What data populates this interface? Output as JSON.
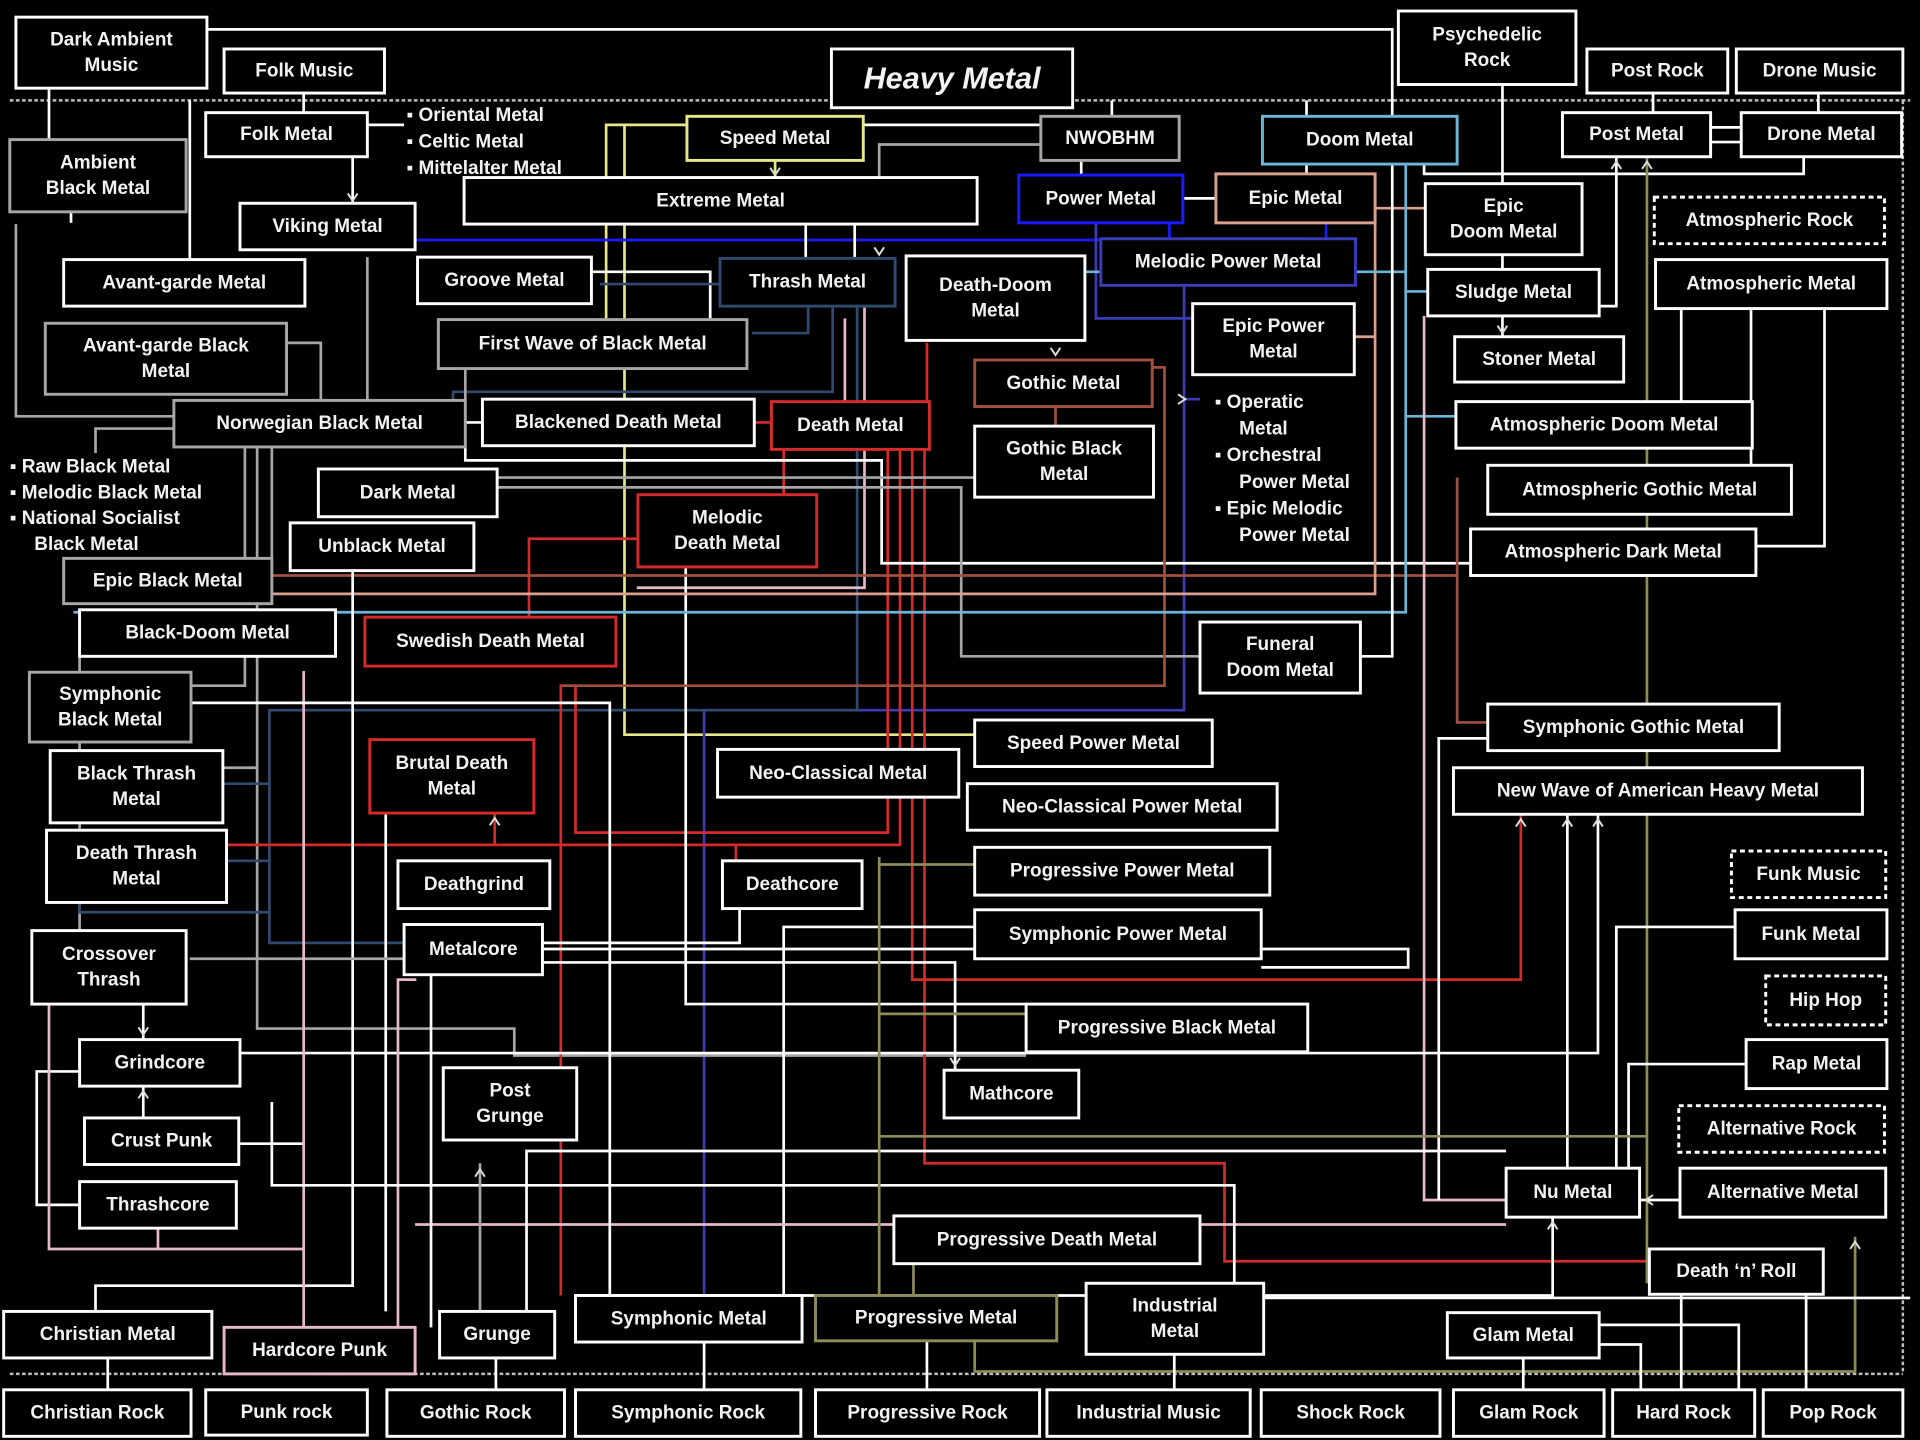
{
  "diagram": {
    "title": "Heavy Metal",
    "colors": {
      "background": "#000000",
      "default_line": "#ffffff",
      "grey": "#a6a6a6",
      "speed": "#e6e68a",
      "power": "#1a1aff",
      "melodic_power": "#3b3bb8",
      "epic": "#d9a090",
      "doom": "#6cb4d8",
      "death": "#d42a2a",
      "thrash": "#2f4a6e",
      "gothic": "#a0503c",
      "pink": "#e6b8c8",
      "progressive": "#8c8c5a",
      "divider": "#bdbdbd"
    },
    "nodes": {
      "dark_ambient_music": "Dark Ambient\nMusic",
      "folk_music": "Folk Music",
      "heavy_metal": "Heavy Metal",
      "psychedelic_rock": "Psychedelic\nRock",
      "post_rock": "Post Rock",
      "drone_music": "Drone Music",
      "ambient_black_metal": "Ambient\nBlack Metal",
      "folk_metal": "Folk Metal",
      "speed_metal": "Speed Metal",
      "nwobhm": "NWOBHM",
      "doom_metal": "Doom Metal",
      "post_metal": "Post Metal",
      "drone_metal": "Drone Metal",
      "extreme_metal": "Extreme Metal",
      "power_metal": "Power Metal",
      "epic_metal": "Epic Metal",
      "epic_doom_metal": "Epic\nDoom Metal",
      "atmospheric_rock": "Atmospheric Rock",
      "viking_metal": "Viking Metal",
      "melodic_power_metal": "Melodic Power Metal",
      "avant_garde_metal": "Avant-garde Metal",
      "groove_metal": "Groove Metal",
      "thrash_metal": "Thrash Metal",
      "death_doom_metal": "Death-Doom\nMetal",
      "sludge_metal": "Sludge Metal",
      "atmospheric_metal": "Atmospheric Metal",
      "avant_garde_black_metal": "Avant-garde Black\nMetal",
      "first_wave_black_metal": "First Wave of Black Metal",
      "epic_power_metal": "Epic Power\nMetal",
      "stoner_metal": "Stoner Metal",
      "gothic_metal": "Gothic Metal",
      "norwegian_black_metal": "Norwegian Black Metal",
      "blackened_death_metal": "Blackened Death Metal",
      "death_metal": "Death Metal",
      "atmospheric_doom_metal": "Atmospheric Doom Metal",
      "gothic_black_metal": "Gothic Black\nMetal",
      "dark_metal": "Dark Metal",
      "atmospheric_gothic_metal": "Atmospheric Gothic Metal",
      "melodic_death_metal": "Melodic\nDeath Metal",
      "unblack_metal": "Unblack Metal",
      "atmospheric_dark_metal": "Atmospheric Dark Metal",
      "epic_black_metal": "Epic Black Metal",
      "black_doom_metal": "Black-Doom  Metal",
      "swedish_death_metal": "Swedish Death Metal",
      "funeral_doom_metal": "Funeral\nDoom Metal",
      "symphonic_black_metal": "Symphonic\nBlack Metal",
      "symphonic_gothic_metal": "Symphonic Gothic Metal",
      "speed_power_metal": "Speed Power Metal",
      "black_thrash_metal": "Black Thrash\nMetal",
      "brutal_death_metal": "Brutal Death\nMetal",
      "neo_classical_metal": "Neo-Classical Metal",
      "new_wave_american_hm": "New Wave of American Heavy  Metal",
      "neo_classical_power_metal": "Neo-Classical Power Metal",
      "death_thrash_metal": "Death Thrash\nMetal",
      "progressive_power_metal": "Progressive Power Metal",
      "funk_music": "Funk Music",
      "deathgrind": "Deathgrind",
      "deathcore": "Deathcore",
      "symphonic_power_metal": "Symphonic Power Metal",
      "funk_metal": "Funk Metal",
      "crossover_thrash": "Crossover\nThrash",
      "metalcore": "Metalcore",
      "hip_hop": "Hip Hop",
      "progressive_black_metal": "Progressive Black Metal",
      "grindcore": "Grindcore",
      "rap_metal": "Rap Metal",
      "post_grunge": "Post\nGrunge",
      "mathcore": "Mathcore",
      "crust_punk": "Crust Punk",
      "alternative_rock": "Alternative Rock",
      "nu_metal": "Nu Metal",
      "alternative_metal": "Alternative Metal",
      "thrashcore": "Thrashcore",
      "progressive_death_metal": "Progressive Death Metal",
      "death_n_roll": "Death ‘n’ Roll",
      "industrial_metal": "Industrial\nMetal",
      "christian_metal": "Christian Metal",
      "hardcore_punk": "Hardcore Punk",
      "grunge": "Grunge",
      "symphonic_metal": "Symphonic Metal",
      "progressive_metal": "Progressive Metal",
      "glam_metal": "Glam Metal",
      "christian_rock": "Christian Rock",
      "punk_rock": "Punk rock",
      "gothic_rock": "Gothic Rock",
      "symphonic_rock": "Symphonic Rock",
      "progressive_rock": "Progressive Rock",
      "industrial_music": "Industrial Music",
      "shock_rock": "Shock Rock",
      "glam_rock": "Glam Rock",
      "hard_rock": "Hard Rock",
      "pop_rock": "Pop Rock"
    },
    "sublists": {
      "folk_metal_subgenres": [
        "Oriental Metal",
        "Celtic Metal",
        "Mittelalter Metal"
      ],
      "norwegian_black_metal_subgenres": [
        "Raw Black Metal",
        "Melodic Black Metal",
        "National Socialist",
        "Black Metal"
      ],
      "power_metal_subgenres": [
        "Operatic",
        "Metal",
        "Orchestral",
        "Power Metal",
        "Epic Melodic",
        "Power Metal"
      ]
    },
    "list_bullet": "▪"
  }
}
